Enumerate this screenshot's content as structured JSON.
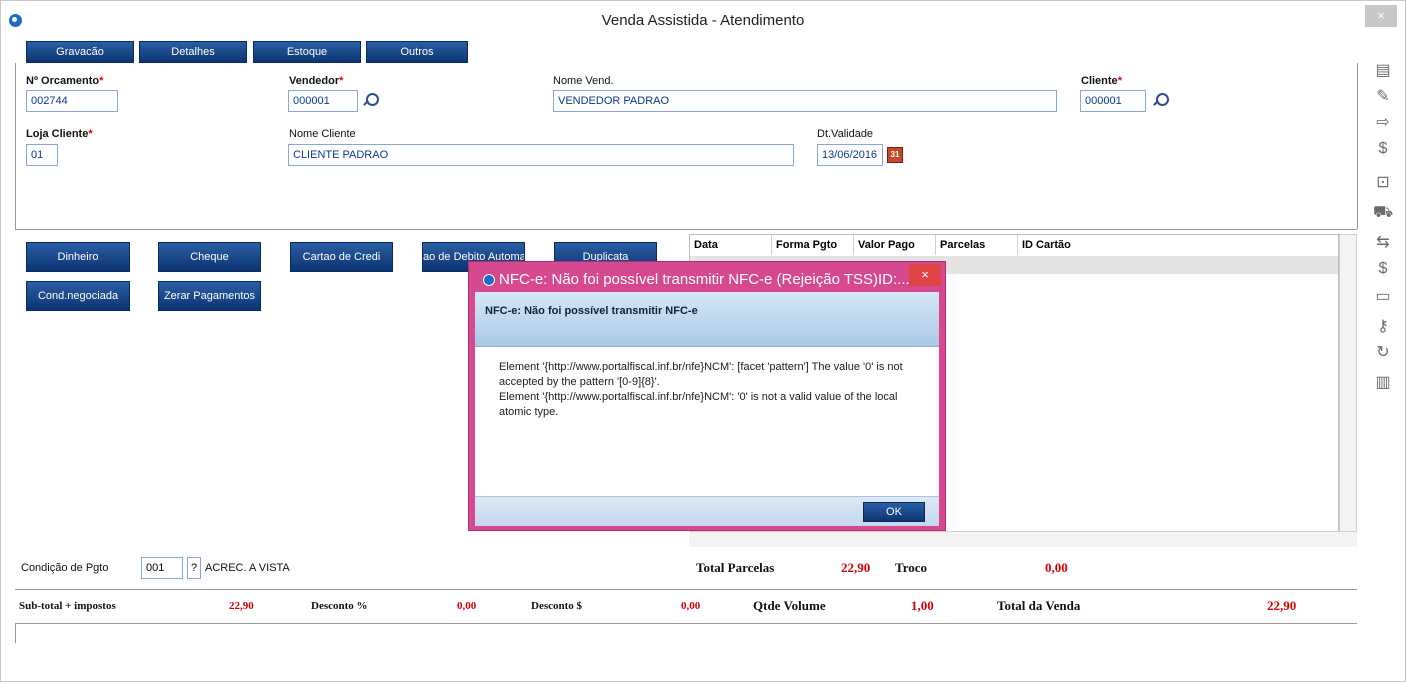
{
  "window": {
    "title": "Venda Assistida - Atendimento",
    "close": "×"
  },
  "nav": [
    "Gravacão",
    "Detalhes",
    "Estoque",
    "Outros"
  ],
  "header": {
    "orcamento_label": "Nº Orcamento",
    "orcamento_value": "002744",
    "vendedor_label": "Vendedor",
    "vendedor_value": "000001",
    "nome_vend_label": "Nome Vend.",
    "nome_vend_value": "VENDEDOR PADRAO",
    "cliente_label": "Cliente",
    "cliente_value": "000001",
    "loja_label": "Loja Cliente",
    "loja_value": "01",
    "nome_cliente_label": "Nome Cliente",
    "nome_cliente_value": "CLIENTE PADRAO",
    "validade_label": "Dt.Validade",
    "validade_value": "13/06/2016",
    "req_mark": "*",
    "calendar_glyph": "31"
  },
  "payment_buttons": {
    "dinheiro": "Dinheiro",
    "cheque": "Cheque",
    "cartao_credito": "Cartao de Credi",
    "debito_auto": "ao de Debito Automa",
    "duplicata": "Duplicata",
    "cond_negociada": "Cond.negociada",
    "zerar": "Zerar Pagamentos"
  },
  "grid": {
    "columns": [
      "Data",
      "Forma Pgto",
      "Valor Pago",
      "Parcelas",
      "ID Cartão"
    ]
  },
  "condicao": {
    "label": "Condição de Pgto",
    "code": "001",
    "help": "?",
    "desc": "ACREC. A VISTA"
  },
  "totals": {
    "parcelas_label": "Total Parcelas",
    "parcelas_value": "22,90",
    "troco_label": "Troco",
    "troco_value": "0,00",
    "subtotal_label": "Sub-total + impostos",
    "subtotal_value": "22,90",
    "desc_pct_label": "Desconto %",
    "desc_pct_value": "0,00",
    "desc_val_label": "Desconto $",
    "desc_val_value": "0,00",
    "volume_label": "Qtde Volume",
    "volume_value": "1,00",
    "venda_label": "Total da Venda",
    "venda_value": "22,90"
  },
  "dialog": {
    "title": "NFC-e: Não foi possível transmitir NFC-e (Rejeição TSS)ID:...",
    "close": "×",
    "header": "NFC-e: Não foi possível transmitir NFC-e",
    "message_1": "Element '{http://www.portalfiscal.inf.br/nfe}NCM': [facet 'pattern'] The value '0' is not accepted by the pattern '[0-9]{8}'.",
    "message_2": "Element '{http://www.portalfiscal.inf.br/nfe}NCM': '0' is not a valid value of the local atomic type.",
    "ok": "OK"
  },
  "colors": {
    "accent": "#0b3472",
    "dialog_border": "#d6498e",
    "value_red": "#d40000"
  }
}
